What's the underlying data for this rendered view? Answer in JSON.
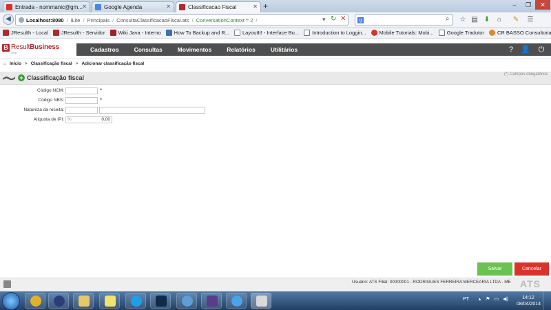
{
  "browser": {
    "tabs": [
      {
        "label": "Entrada - nommanic@gm...",
        "icon": "gmail-icon",
        "color": "#d93025"
      },
      {
        "label": "Google Agenda",
        "icon": "calendar-icon",
        "color": "#4a86e8"
      },
      {
        "label": "Classificacao Fiscal",
        "icon": "result-icon",
        "color": "#b4282d",
        "active": true
      }
    ],
    "new_tab": "+",
    "window_buttons": [
      "–",
      "❐",
      "✕"
    ],
    "url": {
      "host": "Localhost:8080",
      "segments": [
        "iLite",
        "Principais",
        "ConsultaClassificacaoFiscal.ats"
      ],
      "context": "ConversationContext = 2"
    },
    "search_placeholder": "",
    "bookmarks": [
      {
        "label": "JResulth - Local",
        "icon": "result-icon",
        "color": "#b4282d"
      },
      {
        "label": "JResulth - Servidor",
        "icon": "result-icon",
        "color": "#b4282d"
      },
      {
        "label": "Wiki Java - Interno",
        "icon": "wiki-icon",
        "color": "#a02020"
      },
      {
        "label": "How To Backup and R...",
        "icon": "page-icon",
        "color": "#3f6fb0"
      },
      {
        "label": "LayoutIt! - Interface Bu...",
        "icon": "grid-icon",
        "color": "#888888"
      },
      {
        "label": "Introduction to Loggin...",
        "icon": "doc-icon",
        "color": "#777777"
      },
      {
        "label": "Mobile Tutorials: Mobi...",
        "icon": "mobile-icon",
        "color": "#d9332c"
      },
      {
        "label": "Google Tradutor",
        "icon": "doc-icon",
        "color": "#777777"
      },
      {
        "label": "CR BASSO Consultoria...",
        "icon": "cr-icon",
        "color": "#e0892a"
      }
    ]
  },
  "app": {
    "logo_letter": "B",
    "brand_a": "Result",
    "brand_b": "Business",
    "brand_sub": "Web",
    "menu": [
      "Cadastros",
      "Consultas",
      "Movimentos",
      "Relatórios",
      "Utilitários"
    ],
    "breadcrumb": {
      "home": "Início",
      "sep": ">",
      "item1": "Classificação fiscal",
      "item2": "Adicionar classificação fiscal"
    },
    "page_title": "Classificação fiscal",
    "required_note": "(*) Campos obrigatórios",
    "form": {
      "ncm_label": "Código NCM:",
      "nbs_label": "Código NBS:",
      "natureza_label": "Natureza da receita:",
      "aliquota_label": "Alíquota de IPI:",
      "aliquota_prefix": "%",
      "aliquota_value": "0,00",
      "required_mark": "*"
    },
    "save_label": "Salvar",
    "cancel_label": "Cancelar",
    "status": "Usuário: ATS  Filial: 00000001 - RODRIGUES FERREIRA MERCEARIA LTDA - ME",
    "watermark": "ATS"
  },
  "taskbar": {
    "items": [
      {
        "icon": "explorer-icon",
        "color": "#3b7dd8"
      },
      {
        "icon": "chrome-icon",
        "color": "#e0b22a"
      },
      {
        "icon": "eclipse-icon",
        "color": "#2c3e7a"
      },
      {
        "icon": "folder-icon",
        "color": "#e8c76a"
      },
      {
        "icon": "stickies-icon",
        "color": "#f2e36b"
      },
      {
        "icon": "skype-icon",
        "color": "#1ea0e6"
      },
      {
        "icon": "photoshop-icon",
        "color": "#102a4c"
      },
      {
        "icon": "cloud-icon",
        "color": "#5da0d8"
      },
      {
        "icon": "app-icon",
        "color": "#5a3d8a"
      },
      {
        "icon": "itunes-icon",
        "color": "#4aa3e8"
      },
      {
        "icon": "java-icon",
        "color": "#d9d9d9"
      }
    ],
    "lang": "PT",
    "time": "14:12",
    "date": "08/04/2014"
  }
}
